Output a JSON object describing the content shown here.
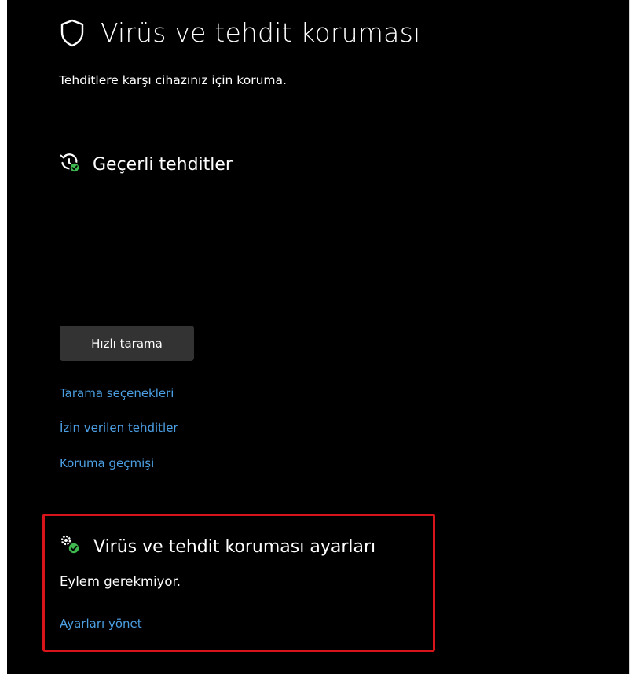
{
  "page": {
    "title": "Virüs ve tehdit koruması",
    "subtitle": "Tehditlere karşı cihazınız için koruma.",
    "title_icon": "shield-icon"
  },
  "current_threats": {
    "title": "Geçerli tehditler",
    "icon": "history-check-icon",
    "quick_scan_label": "Hızlı tarama",
    "links": [
      "Tarama seçenekleri",
      "İzin verilen tehditler",
      "Koruma geçmişi"
    ]
  },
  "settings": {
    "title": "Virüs ve tehdit koruması ayarları",
    "icon": "gear-check-icon",
    "status": "Eylem gerekmiyor.",
    "manage_link": "Ayarları yönet",
    "highlight_color": "#d7141a"
  },
  "colors": {
    "background": "#000000",
    "link": "#4c9fe3",
    "button": "#333333",
    "status_ok": "#3fb950"
  }
}
